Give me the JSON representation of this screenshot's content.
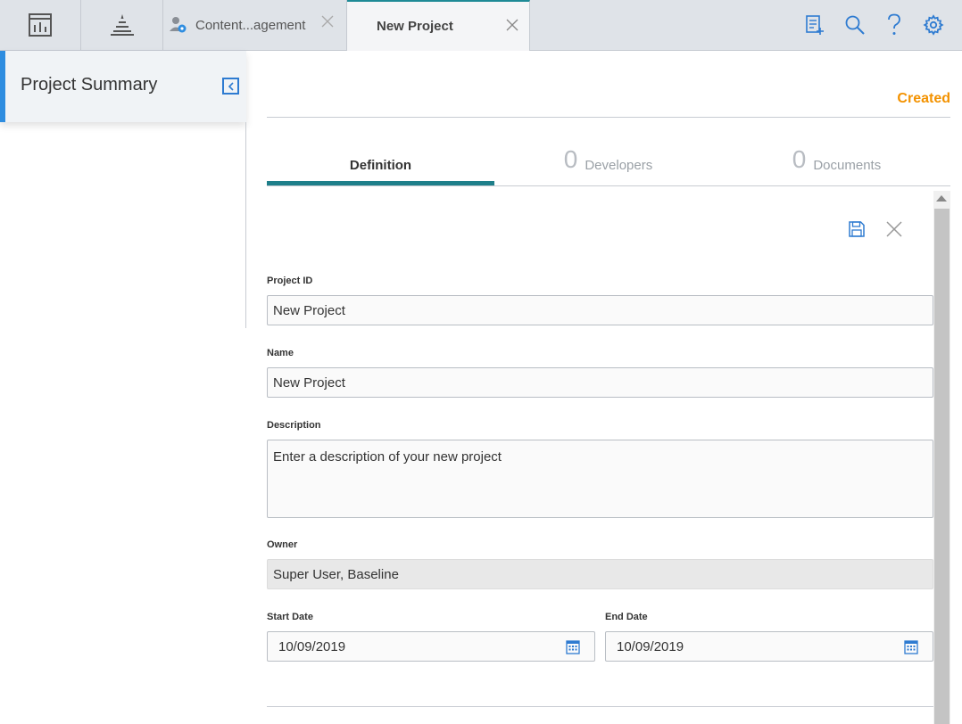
{
  "tabs": {
    "content_tab_label": "Content...agement",
    "active_tab_label": "New Project"
  },
  "icons": {
    "dashboard": "dashboard-icon",
    "pyramid": "pyramid-icon",
    "content_management": "user-gear-icon",
    "close": "close-icon",
    "add_report": "add-report-icon",
    "search": "search-icon",
    "help": "help-icon",
    "settings": "gear-icon",
    "collapse": "collapse-left-icon",
    "save": "save-icon",
    "cancel": "close-icon",
    "calendar": "calendar-icon"
  },
  "sidebar": {
    "title": "Project Summary"
  },
  "main": {
    "status": "Created",
    "subtabs": [
      {
        "label": "Definition"
      },
      {
        "count": "0",
        "label": "Developers"
      },
      {
        "count": "0",
        "label": "Documents"
      }
    ],
    "form": {
      "project_id": {
        "label": "Project ID",
        "value": "New Project"
      },
      "name": {
        "label": "Name",
        "value": "New Project"
      },
      "description": {
        "label": "Description",
        "placeholder": "Enter a description of your new project"
      },
      "owner": {
        "label": "Owner",
        "value": "Super User, Baseline"
      },
      "start_date": {
        "label": "Start Date",
        "value": "10/09/2019"
      },
      "end_date": {
        "label": "End Date",
        "value": "10/09/2019"
      }
    }
  },
  "colors": {
    "accent_teal": "#1e7f8a",
    "accent_blue": "#2e8de0",
    "status_orange": "#f39200"
  }
}
